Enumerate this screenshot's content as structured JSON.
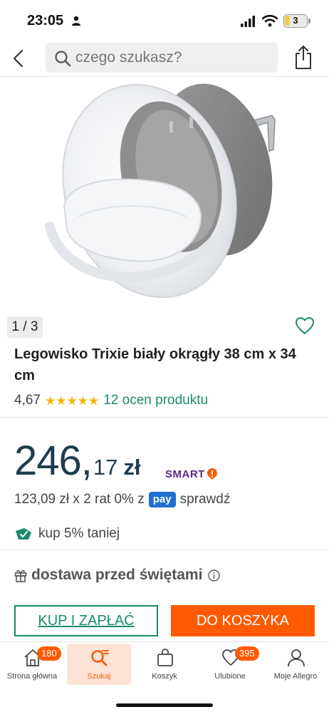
{
  "status_bar": {
    "time": "23:05",
    "battery": "3"
  },
  "search": {
    "placeholder": "czego szukasz?"
  },
  "gallery": {
    "counter": "1 / 3"
  },
  "product": {
    "title": "Legowisko Trixie biały okrągły 38 cm x 34 cm",
    "rating": "4,67",
    "stars": 5,
    "ratings_link": "12 ocen produktu"
  },
  "price": {
    "main": "246,",
    "cents": "17",
    "currency": "zł",
    "smart_label": "SMART"
  },
  "installments": {
    "text": "123,09 zł x 2 rat 0% z",
    "pay_label": "pay",
    "check": "sprawdź"
  },
  "discount": {
    "text": "kup 5% taniej"
  },
  "delivery": {
    "text": "dostawa przed świętami"
  },
  "actions": {
    "buy_label": "KUP I ZAPŁAĆ",
    "cart_label": "DO KOSZYKA"
  },
  "bottom_nav": {
    "items": [
      {
        "label": "Strona główna",
        "badge": "180"
      },
      {
        "label": "Szukaj"
      },
      {
        "label": "Koszyk"
      },
      {
        "label": "Ulubione",
        "badge": "395"
      },
      {
        "label": "Moje Allegro"
      }
    ]
  },
  "colors": {
    "accent_green": "#1a8a6e",
    "accent_orange": "#ff5a00",
    "price_dark": "#1f3c4d",
    "star": "#f5b301"
  }
}
